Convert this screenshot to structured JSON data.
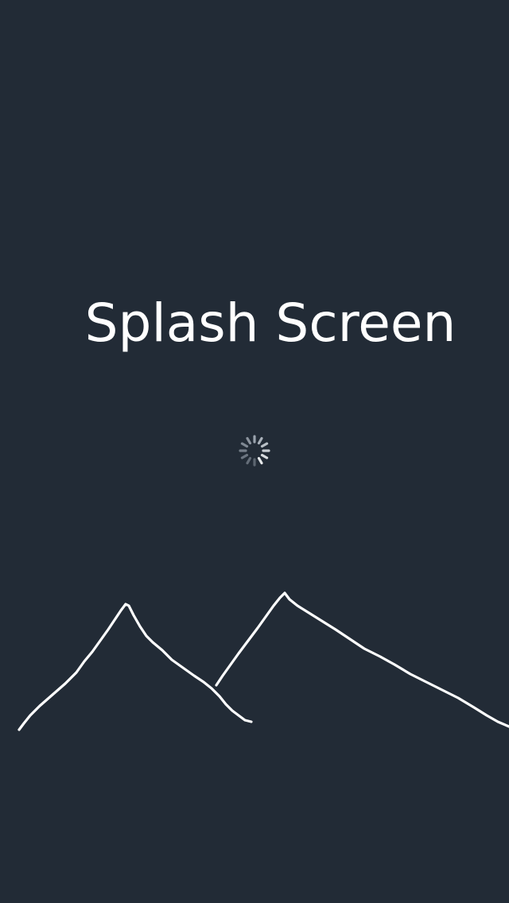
{
  "screen": {
    "title": "Splash Screen",
    "background_color": "#222b36",
    "title_color": "#ffffff",
    "spinner_icon": "loading-spinner-icon",
    "illustration_icon": "mountains-icon",
    "line_color": "#ffffff"
  }
}
